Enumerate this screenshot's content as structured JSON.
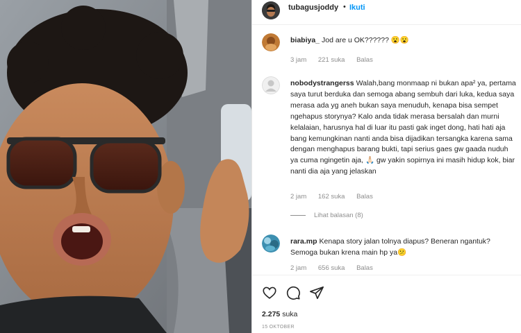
{
  "post": {
    "username": "tubagusjoddy",
    "separator": "•",
    "follow_label": "Ikuti"
  },
  "comments": [
    {
      "username": "biabiya_",
      "text": "Jod are u OK?????? 😮😮",
      "time": "3 jam",
      "likes": "221 suka",
      "reply_label": "Balas"
    },
    {
      "username": "nobodystrangerss",
      "text": "Walah,bang monmaap ni bukan apa² ya, pertama saya turut berduka dan semoga abang sembuh dari luka, kedua saya merasa ada yg aneh bukan saya menuduh, kenapa bisa sempet ngehapus storynya? Kalo anda tidak merasa bersalah dan murni kelalaian, harusnya hal di luar itu pasti gak inget dong, hati hati aja bang kemungkinan nanti anda bisa dijadikan tersangka karena sama dengan menghapus barang bukti, tapi serius gaes gw gaada nuduh ya cuma ngingetin aja, 🙏🏻 gw yakin sopirnya ini masih hidup kok, biar nanti dia aja yang jelaskan",
      "time": "2 jam",
      "likes": "162 suka",
      "reply_label": "Balas",
      "view_replies": "Lihat balasan (8)"
    },
    {
      "username": "rara.mp",
      "text": "Kenapa story jalan tolnya diapus? Beneran ngantuk? Semoga bukan krena main hp ya😕",
      "time": "2 jam",
      "likes": "656 suka",
      "reply_label": "Balas"
    }
  ],
  "actions": {
    "like_icon": "heart-icon",
    "comment_icon": "comment-bubble-icon",
    "share_icon": "paper-plane-icon",
    "likes_count": "2.275",
    "likes_label": "suka",
    "date": "15 OKTOBER"
  },
  "colors": {
    "link": "#0095f6",
    "muted": "#8e8e8e",
    "text": "#262626"
  }
}
